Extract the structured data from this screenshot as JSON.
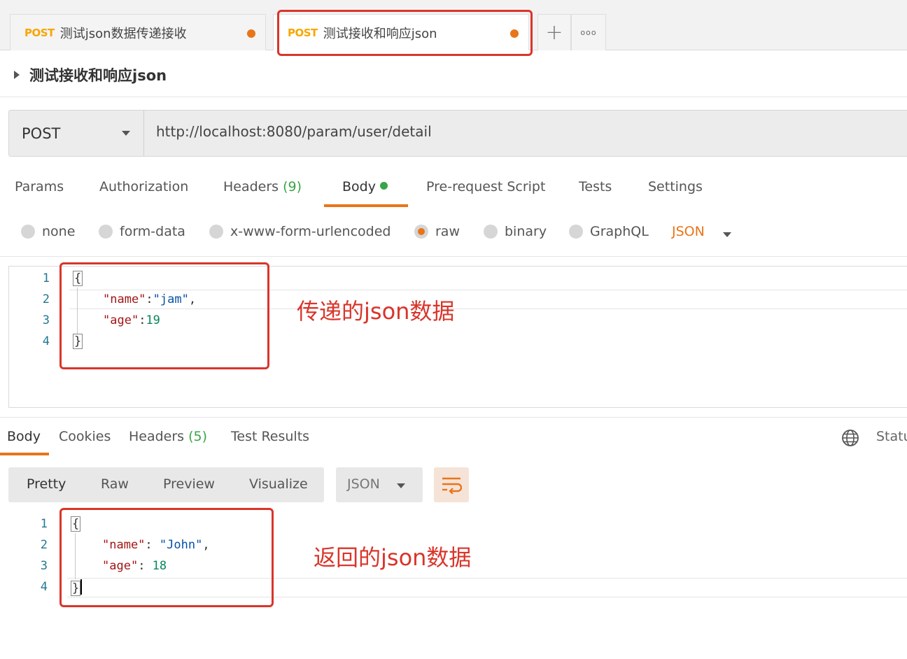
{
  "tabs": [
    {
      "method": "POST",
      "name": "测试json数据传递接收"
    },
    {
      "method": "POST",
      "name": "测试接收和响应json"
    }
  ],
  "tab_more_label": "ooo",
  "request": {
    "title": "测试接收和响应json",
    "method": "POST",
    "url": "http://localhost:8080/param/user/detail"
  },
  "request_tabs": {
    "params": "Params",
    "authorization": "Authorization",
    "headers": "Headers",
    "headers_count": "(9)",
    "body": "Body",
    "prerequest": "Pre-request Script",
    "tests": "Tests",
    "settings": "Settings"
  },
  "body_types": {
    "none": "none",
    "form_data": "form-data",
    "urlencoded": "x-www-form-urlencoded",
    "raw": "raw",
    "binary": "binary",
    "graphql": "GraphQL",
    "format": "JSON",
    "selected": "raw"
  },
  "request_body": {
    "line_numbers": [
      "1",
      "2",
      "3",
      "4"
    ],
    "open_brace": "{",
    "close_brace": "}",
    "k1": "\"name\"",
    "sep1": ":",
    "v1": "\"jam\"",
    "c1": ",",
    "k2": "\"age\"",
    "sep2": ":",
    "v2": "19"
  },
  "annotations": {
    "request": "传递的json数据",
    "response": "返回的json数据"
  },
  "response_tabs": {
    "body": "Body",
    "cookies": "Cookies",
    "headers": "Headers",
    "headers_count": "(5)",
    "test_results": "Test Results",
    "status": "Status"
  },
  "response_view": {
    "pretty": "Pretty",
    "raw": "Raw",
    "preview": "Preview",
    "visualize": "Visualize",
    "format": "JSON"
  },
  "response_body": {
    "line_numbers": [
      "1",
      "2",
      "3",
      "4"
    ],
    "open_brace": "{",
    "close_brace": "}",
    "k1": "\"name\"",
    "sep1": ": ",
    "v1": "\"John\"",
    "c1": ",",
    "k2": "\"age\"",
    "sep2": ": ",
    "v2": "18"
  },
  "colors": {
    "accent": "#e8751a",
    "method_post": "#f7a600",
    "annotation": "#d9352b",
    "count_green": "#3aa547"
  }
}
